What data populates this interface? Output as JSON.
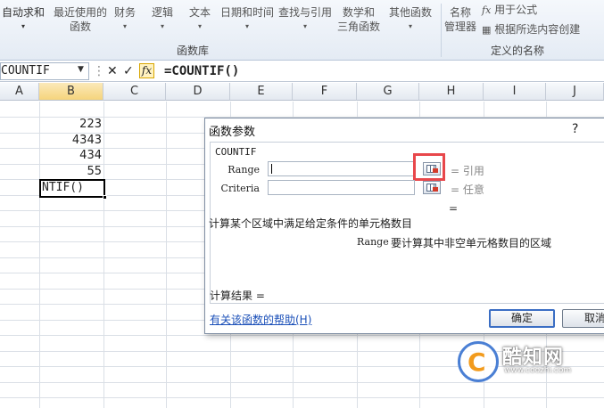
{
  "ribbon": {
    "autosum": "自动求和",
    "recent_1": "最近使用的",
    "recent_2": "函数",
    "finance": "财务",
    "logic": "逻辑",
    "text": "文本",
    "datetime": "日期和时间",
    "lookup": "查找与引用",
    "math_1": "数学和",
    "math_2": "三角函数",
    "other": "其他函数",
    "library_label": "函数库",
    "name_mgr_1": "名称",
    "name_mgr_2": "管理器",
    "use_in_formula": "用于公式",
    "create_from_sel": "根据所选内容创建",
    "defined_names_label": "定义的名称"
  },
  "formula_bar": {
    "name_box": "COUNTIF",
    "fx": "fx",
    "formula": "=COUNTIF()"
  },
  "columns": [
    "A",
    "B",
    "C",
    "D",
    "E",
    "F",
    "G",
    "H",
    "I",
    "J"
  ],
  "cells": {
    "b2": "223",
    "b3": "4343",
    "b4": "434",
    "b5": "55",
    "active": "NTIF()"
  },
  "dialog": {
    "title": "函数参数",
    "help": "?",
    "function_name": "COUNTIF",
    "arg1_label": "Range",
    "arg1_value": "",
    "arg1_result": "= 引用",
    "arg2_label": "Criteria",
    "arg2_value": "",
    "arg2_result": "= 任意",
    "eq": "=",
    "description": "计算某个区域中满足给定条件的单元格数目",
    "arg_desc_name": "Range",
    "arg_desc": "要计算其中非空单元格数目的区域",
    "result": "计算结果 =",
    "help_link": "有关该函数的帮助(H)",
    "ok": "确定",
    "cancel": "取消"
  },
  "watermark": {
    "logo_letter": "C",
    "brand": "酷知网",
    "url": "www.coozhi.com"
  }
}
